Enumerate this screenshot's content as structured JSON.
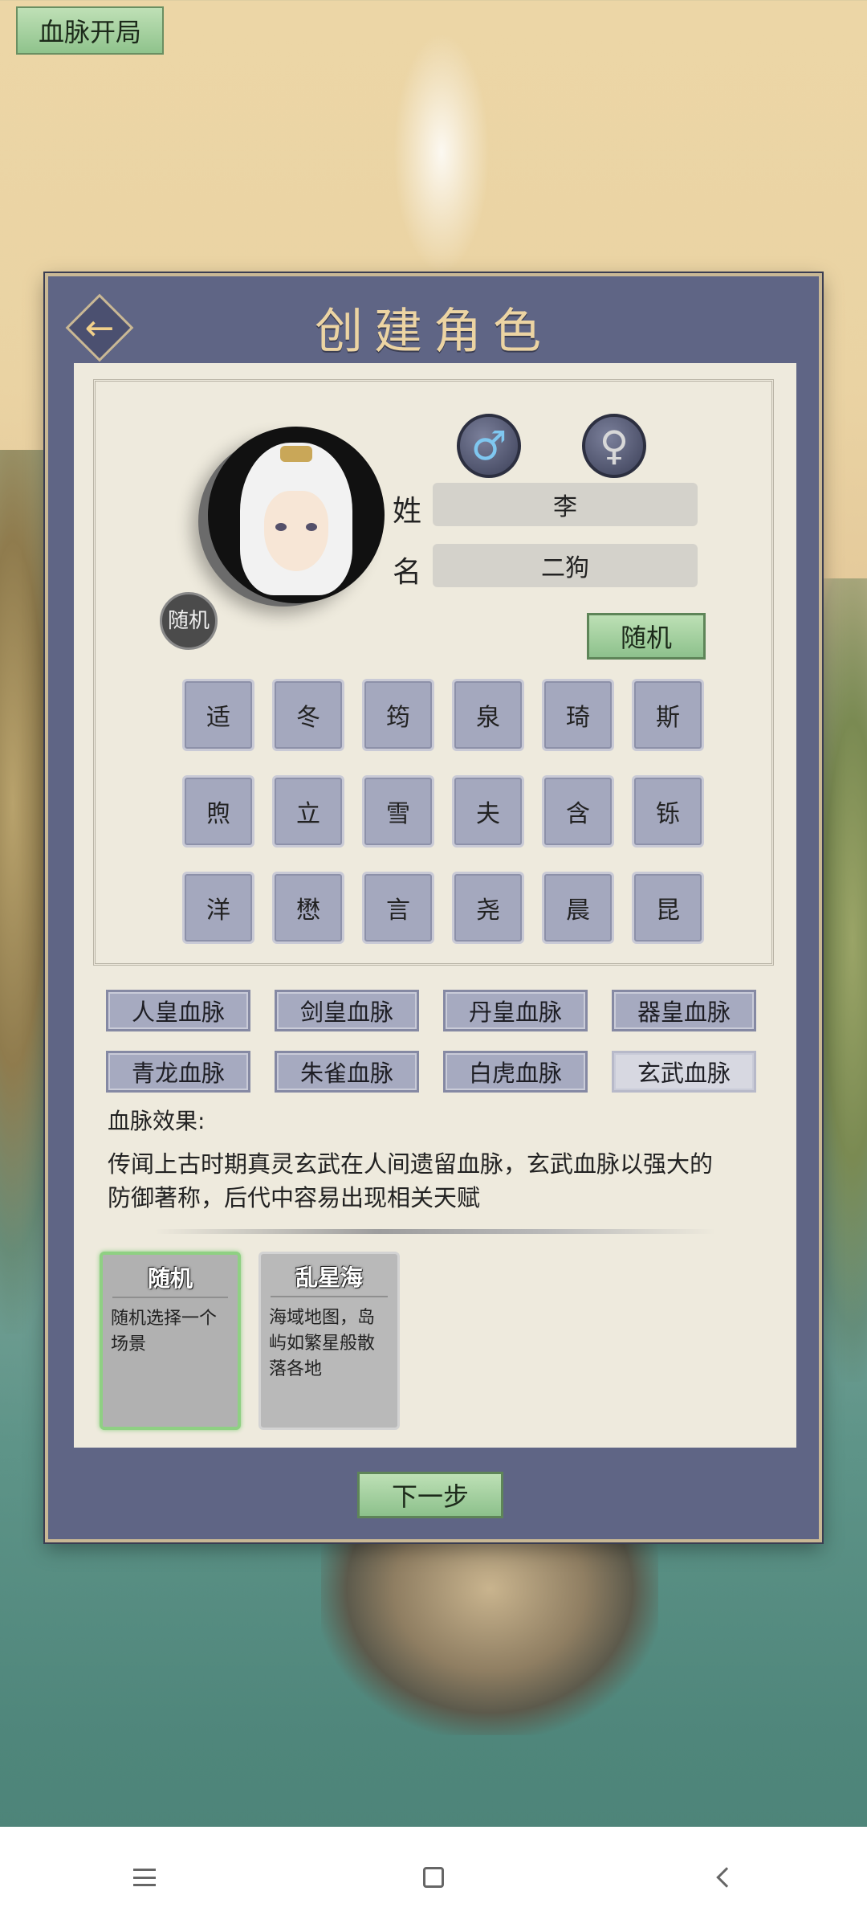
{
  "header": {
    "mode_tag": "血脉开局"
  },
  "panel": {
    "title": "创建角色"
  },
  "avatar": {
    "random_label": "随机"
  },
  "gender": {
    "male_symbol": "♂",
    "female_symbol": "♀"
  },
  "name": {
    "surname_label": "姓",
    "surname_value": "李",
    "given_label": "名",
    "given_value": "二狗",
    "random_button": "随机"
  },
  "chars": [
    "适",
    "冬",
    "筠",
    "泉",
    "琦",
    "斯",
    "煦",
    "立",
    "雪",
    "夫",
    "含",
    "铄",
    "洋",
    "懋",
    "言",
    "尧",
    "晨",
    "昆"
  ],
  "bloodlines": [
    {
      "label": "人皇血脉",
      "selected": false
    },
    {
      "label": "剑皇血脉",
      "selected": false
    },
    {
      "label": "丹皇血脉",
      "selected": false
    },
    {
      "label": "器皇血脉",
      "selected": false
    },
    {
      "label": "青龙血脉",
      "selected": false
    },
    {
      "label": "朱雀血脉",
      "selected": false
    },
    {
      "label": "白虎血脉",
      "selected": false
    },
    {
      "label": "玄武血脉",
      "selected": true
    }
  ],
  "effect": {
    "label": "血脉效果:",
    "text": "传闻上古时期真灵玄武在人间遗留血脉，玄武血脉以强大的防御著称，后代中容易出现相关天赋"
  },
  "scenes": [
    {
      "title": "随机",
      "desc": "随机选择一个场景",
      "selected": true
    },
    {
      "title": "乱星海",
      "desc": "海域地图，岛屿如繁星般散落各地",
      "selected": false
    }
  ],
  "next_button": "下一步",
  "colors": {
    "accent_green": "#8dc18c",
    "panel": "#5f6585",
    "title_gold": "#ecd4a3"
  }
}
